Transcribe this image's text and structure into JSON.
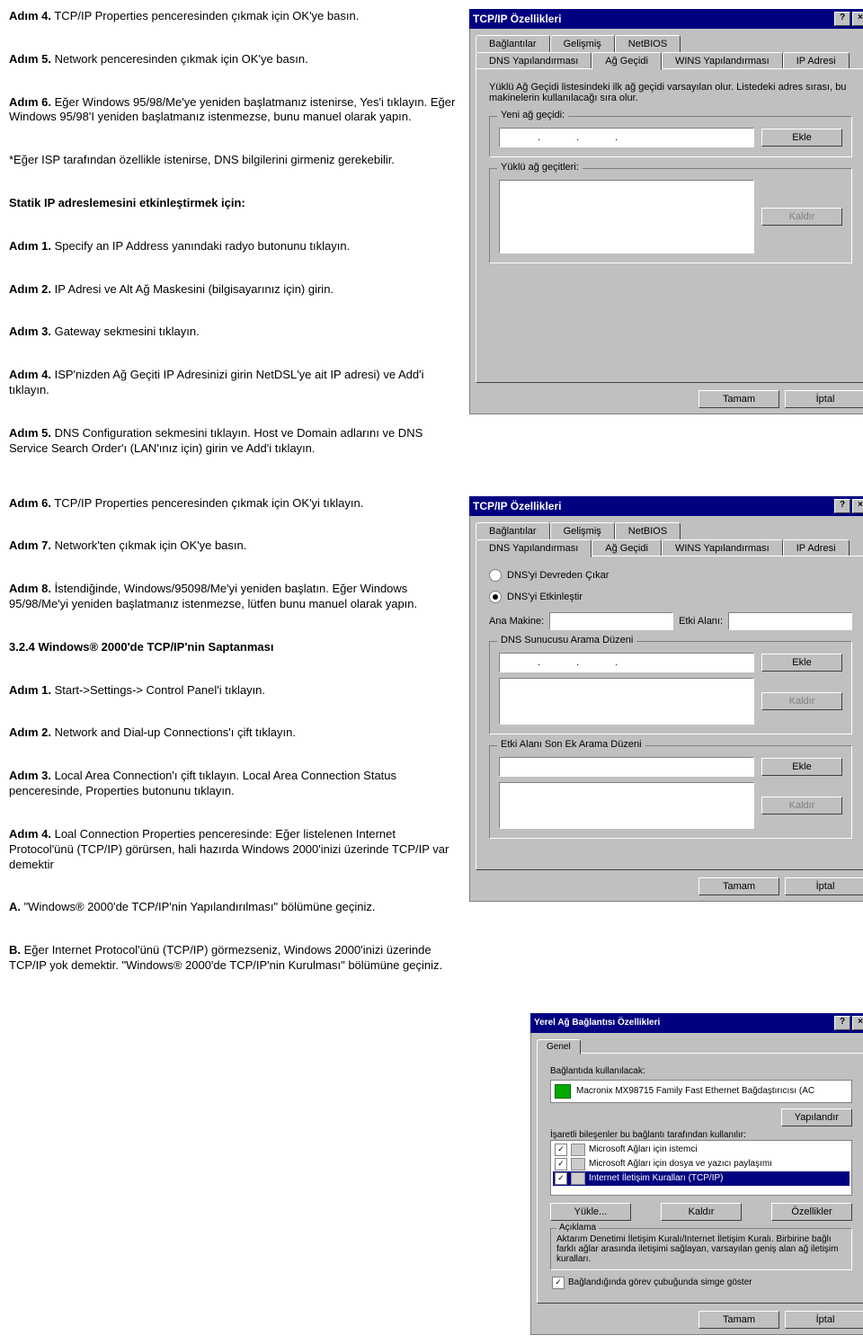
{
  "left1": {
    "p1a": "Adım 4.",
    "p1b": "TCP/IP Properties penceresinden çıkmak için OK'ye basın.",
    "p2a": "Adım 5.",
    "p2b": "Network penceresinden çıkmak için OK'ye basın.",
    "p3a": "Adım 6.",
    "p3b": "Eğer Windows 95/98/Me'ye yeniden başlatmanız istenirse, Yes'i tıklayın. Eğer Windows 95/98'I yeniden başlatmanız istenmezse, bunu manuel olarak yapın.",
    "p4": "*Eğer ISP tarafından özellikle istenirse, DNS bilgilerini girmeniz gerekebilir.",
    "p5": "Statik IP adreslemesini etkinleştirmek için:",
    "p6a": "Adım 1.",
    "p6b": "Specify an IP Address yanındaki radyo butonunu tıklayın.",
    "p7a": "Adım 2.",
    "p7b": "IP Adresi ve Alt Ağ Maskesini (bilgisayarınız için) girin.",
    "p8a": "Adım 3.",
    "p8b": "Gateway sekmesini tıklayın.",
    "p9a": "Adım 4.",
    "p9b": "ISP'nizden Ağ Geçiti IP Adresinizi girin NetDSL'ye ait IP adresi) ve Add'i tıklayın.",
    "p10a": "Adım 5.",
    "p10b": "DNS Configuration sekmesini tıklayın. Host ve Domain adlarını ve DNS Service Search Order'ı (LAN'ınız için) girin ve Add'i tıklayın."
  },
  "left2": {
    "p1a": "Adım 6.",
    "p1b": "TCP/IP Properties penceresinden çıkmak için OK'yi tıklayın.",
    "p2a": "Adım 7.",
    "p2b": "Network'ten çıkmak için OK'ye basın.",
    "p3a": "Adım 8.",
    "p3b": "İstendiğinde, Windows/95098/Me'yi yeniden başlatın. Eğer Windows 95/98/Me'yi yeniden başlatmanız istenmezse, lütfen bunu manuel olarak yapın.",
    "p4": "3.2.4 Windows® 2000'de TCP/IP'nin Saptanması",
    "p5a": "Adım 1.",
    "p5b": "Start->Settings-> Control Panel'i tıklayın.",
    "p6a": "Adım 2.",
    "p6b": "Network and Dial-up Connections'ı çift tıklayın.",
    "p7a": "Adım 3.",
    "p7b": "Local Area Connection'ı çift tıklayın. Local Area Connection Status penceresinde, Properties butonunu tıklayın.",
    "p8a": "Adım 4.",
    "p8b": "Loal Connection Properties penceresinde: Eğer listelenen Internet Protocol'ünü (TCP/IP) görürsen, hali hazırda Windows 2000'inizi üzerinde TCP/IP var demektir",
    "p9a": "A.",
    "p9b": "\"Windows® 2000'de TCP/IP'nin Yapılandırılması\" bölümüne geçiniz.",
    "p10a": "B.",
    "p10b": "Eğer Internet Protocol'ünü (TCP/IP) görmezseniz, Windows 2000'inizi üzerinde TCP/IP yok demektir. \"Windows® 2000'de TCP/IP'nin Kurulması\" bölümüne geçiniz."
  },
  "dlg1": {
    "title": "TCP/IP Özellikleri",
    "tabs_back": [
      "Bağlantılar",
      "Gelişmiş",
      "NetBIOS"
    ],
    "tabs_front": [
      "DNS Yapılandırması",
      "Ağ Geçidi",
      "WINS Yapılandırması",
      "IP Adresi"
    ],
    "active_tab": "Ağ Geçidi",
    "desc": "Yüklü Ağ Geçidi listesindeki ilk ağ geçidi varsayılan olur. Listedeki adres sırası, bu makinelerin kullanılacağı sıra olur.",
    "grp1": "Yeni ağ geçidi:",
    "btn_add": "Ekle",
    "grp2": "Yüklü ağ geçitleri:",
    "btn_remove": "Kaldır",
    "ok": "Tamam",
    "cancel": "İptal"
  },
  "dlg2": {
    "title": "TCP/IP Özellikleri",
    "tabs_back": [
      "Bağlantılar",
      "Gelişmiş",
      "NetBIOS"
    ],
    "tabs_front": [
      "DNS Yapılandırması",
      "Ağ Geçidi",
      "WINS Yapılandırması",
      "IP Adresi"
    ],
    "active_tab": "DNS Yapılandırması",
    "radio_off": "DNS'yi Devreden Çıkar",
    "radio_on": "DNS'yi Etkinleştir",
    "host_lbl": "Ana Makine:",
    "domain_lbl": "Etki Alanı:",
    "grp1": "DNS Sunucusu Arama Düzeni",
    "grp2": "Etki Alanı Son Ek Arama Düzeni",
    "btn_add": "Ekle",
    "btn_remove": "Kaldır",
    "ok": "Tamam",
    "cancel": "İptal"
  },
  "dlg3": {
    "title": "Yerel Ağ Bağlantısı Özellikleri",
    "tab": "Genel",
    "lbl1": "Bağlantıda kullanılacak:",
    "nic": "Macronix MX98715 Family Fast Ethernet Bağdaştırıcısı (AC",
    "btn_conf": "Yapılandır",
    "lbl2": "İşaretli bileşenler bu bağlantı tarafından kullanılır:",
    "items": [
      "Microsoft Ağları için istemci",
      "Microsoft Ağları için dosya ve yazıcı paylaşımı",
      "Internet İletişim Kuralları (TCP/IP)"
    ],
    "btn_install": "Yükle...",
    "btn_remove": "Kaldır",
    "btn_props": "Özellikler",
    "grp_desc": "Açıklama",
    "desc": "Aktarım Denetimi İletişim Kuralı/Internet İletişim Kuralı. Birbirine bağlı farklı ağlar arasında iletişimi sağlayan, varsayılan geniş alan ağ iletişim kuralları.",
    "chk_tray": "Bağlandığında görev çubuğunda simge göster",
    "ok": "Tamam",
    "cancel": "İptal"
  }
}
